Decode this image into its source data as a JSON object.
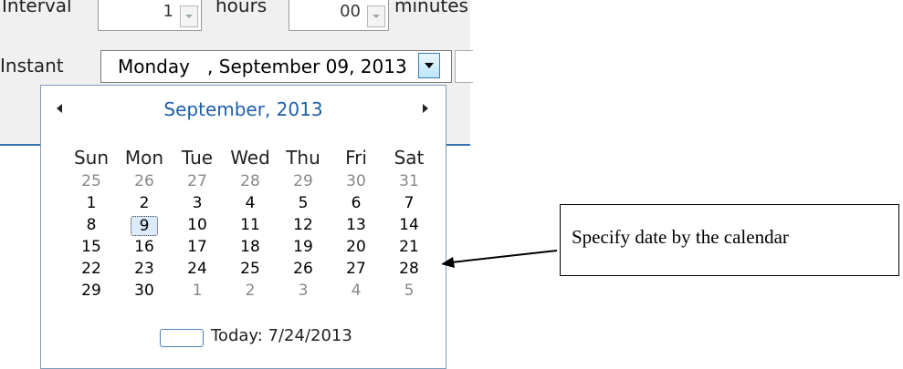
{
  "top_row": {
    "interval_label": "Interval",
    "hours_value": "1",
    "hours_label": "hours",
    "minutes_value": "00",
    "minutes_label": "minutes"
  },
  "date_field": {
    "label": "Instant",
    "value": "Monday   , September 09, 2013"
  },
  "calendar": {
    "month_title": "September, 2013",
    "weekdays": [
      "Sun",
      "Mon",
      "Tue",
      "Wed",
      "Thu",
      "Fri",
      "Sat"
    ],
    "weeks": [
      [
        "25",
        "26",
        "27",
        "28",
        "29",
        "30",
        "31"
      ],
      [
        "1",
        "2",
        "3",
        "4",
        "5",
        "6",
        "7"
      ],
      [
        "8",
        "9",
        "10",
        "11",
        "12",
        "13",
        "14"
      ],
      [
        "15",
        "16",
        "17",
        "18",
        "19",
        "20",
        "21"
      ],
      [
        "22",
        "23",
        "24",
        "25",
        "26",
        "27",
        "28"
      ],
      [
        "29",
        "30",
        "1",
        "2",
        "3",
        "4",
        "5"
      ]
    ],
    "selected_day": "9",
    "today_label": "Today: 7/24/2013"
  },
  "annotation": {
    "text": "Specify date by the calendar"
  },
  "colors": {
    "accent": "#1f5fa8",
    "other_month": "#888888"
  }
}
